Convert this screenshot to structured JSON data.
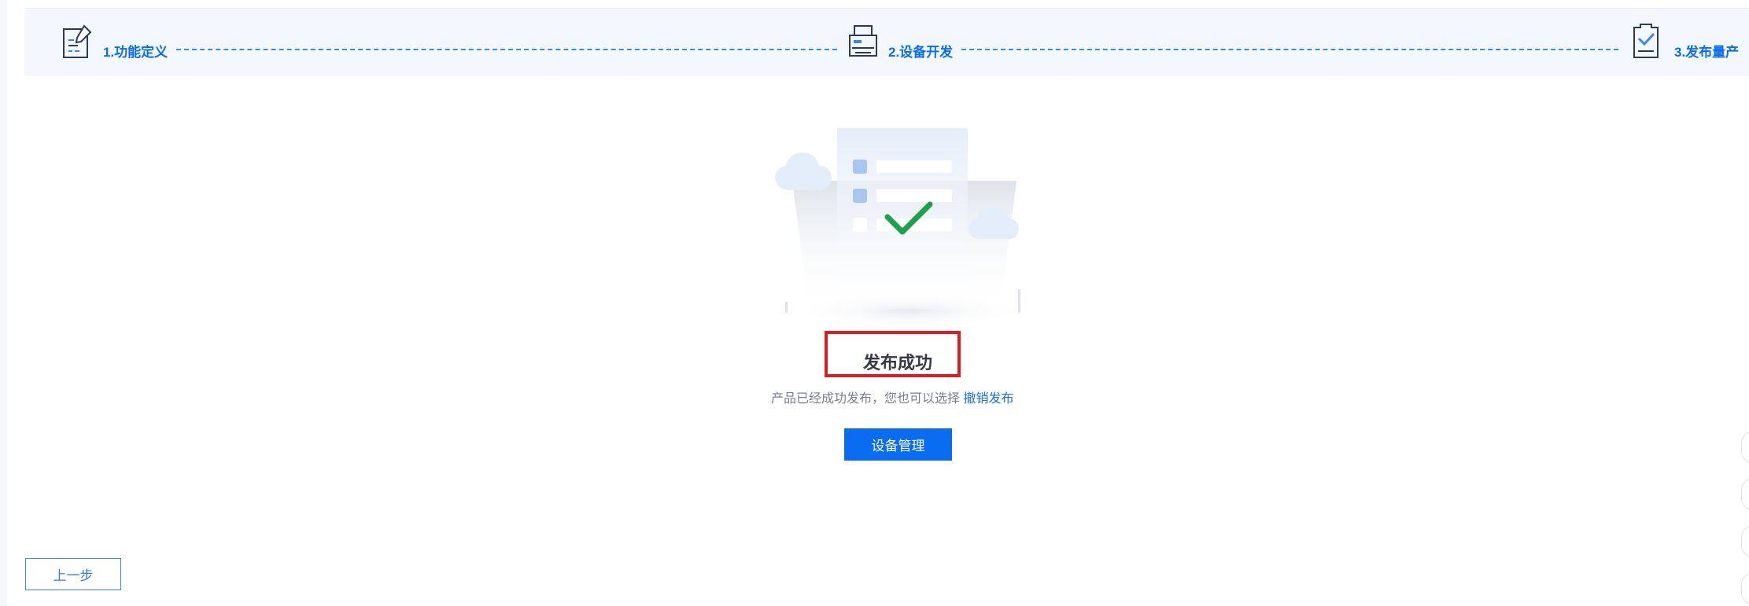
{
  "steps": [
    {
      "label": "1.功能定义",
      "icon": "document-edit-icon"
    },
    {
      "label": "2.设备开发",
      "icon": "printer-device-icon"
    },
    {
      "label": "3.发布量产",
      "icon": "clipboard-check-icon"
    }
  ],
  "result": {
    "title": "发布成功",
    "description": "产品已经成功发布，您也可以选择",
    "revoke_link": "撤销发布"
  },
  "actions": {
    "primary_label": "设备管理",
    "prev_label": "上一步"
  },
  "colors": {
    "accent": "#0a6cf0",
    "success": "#1aa34a",
    "highlight": "#e11b22",
    "steps_bg": "#f3f8fe"
  }
}
